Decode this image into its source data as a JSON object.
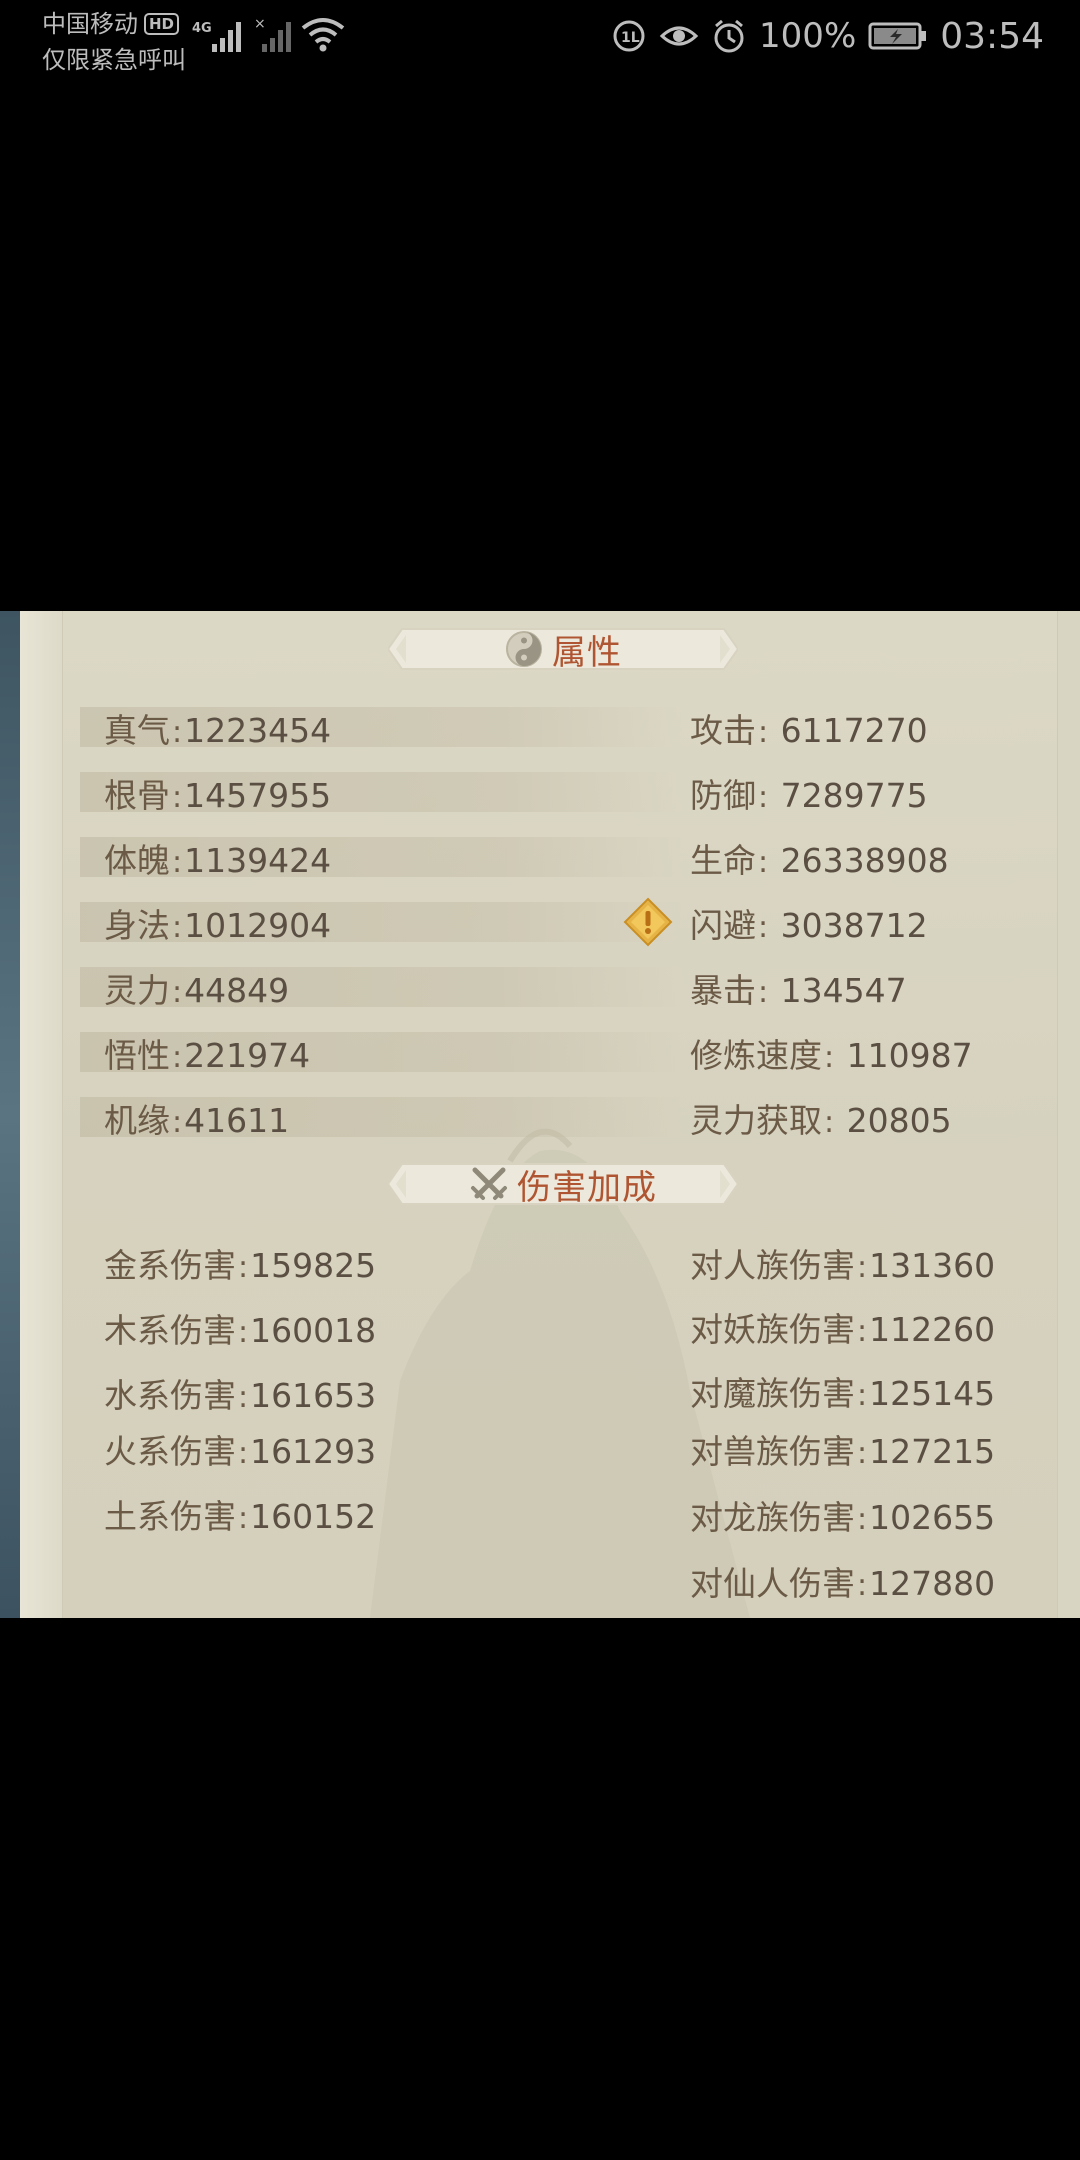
{
  "status_bar": {
    "carrier": "中国移动",
    "hd_badge": "HD",
    "network": "4G",
    "emergency_text": "仅限紧急呼叫",
    "battery_percent": "100%",
    "time": "03:54",
    "icons": [
      "hd-icon",
      "signal-4g-icon",
      "signal-no-sim-icon",
      "wifi-icon",
      "nfc-icon",
      "eye-comfort-icon",
      "alarm-icon",
      "battery-charging-icon"
    ]
  },
  "attributes": {
    "title": "属性",
    "icon": "yin-yang-icon",
    "left": [
      {
        "label": "真气",
        "value": "1223454"
      },
      {
        "label": "根骨",
        "value": "1457955"
      },
      {
        "label": "体魄",
        "value": "1139424"
      },
      {
        "label": "身法",
        "value": "1012904"
      },
      {
        "label": "灵力",
        "value": "44849"
      },
      {
        "label": "悟性",
        "value": "221974"
      },
      {
        "label": "机缘",
        "value": "41611"
      }
    ],
    "right": [
      {
        "label": "攻击",
        "value": "6117270"
      },
      {
        "label": "防御",
        "value": "7289775"
      },
      {
        "label": "生命",
        "value": "26338908"
      },
      {
        "label": "闪避",
        "value": "3038712"
      },
      {
        "label": "暴击",
        "value": "134547"
      },
      {
        "label": "修炼速度",
        "value": "110987"
      },
      {
        "label": "灵力获取",
        "value": "20805"
      }
    ],
    "warning_icon": "warning-diamond-icon"
  },
  "damage": {
    "title": "伤害加成",
    "icon": "crossed-swords-icon",
    "left": [
      {
        "label": "金系伤害",
        "value": "159825"
      },
      {
        "label": "木系伤害",
        "value": "160018"
      },
      {
        "label": "水系伤害",
        "value": "161653"
      },
      {
        "label": "火系伤害",
        "value": "161293"
      },
      {
        "label": "土系伤害",
        "value": "160152"
      }
    ],
    "right": [
      {
        "label": "对人族伤害",
        "value": "131360"
      },
      {
        "label": "对妖族伤害",
        "value": "112260"
      },
      {
        "label": "对魔族伤害",
        "value": "125145"
      },
      {
        "label": "对兽族伤害",
        "value": "127215"
      },
      {
        "label": "对龙族伤害",
        "value": "102655"
      },
      {
        "label": "对仙人伤害",
        "value": "127880"
      }
    ]
  },
  "colors": {
    "title_accent": "#b05532",
    "panel_bg": "#dcd8c6",
    "text": "#5a4f42",
    "warning": "#e0a93a"
  }
}
